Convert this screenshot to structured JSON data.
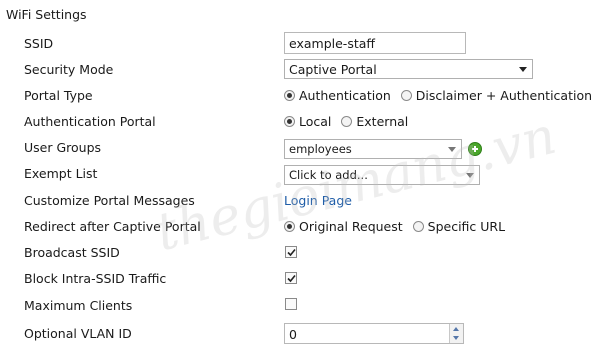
{
  "section_title": "WiFi Settings",
  "fields": {
    "ssid": {
      "label": "SSID",
      "value": "example-staff"
    },
    "security_mode": {
      "label": "Security Mode",
      "value": "Captive Portal"
    },
    "portal_type": {
      "label": "Portal Type",
      "options": [
        "Authentication",
        "Disclaimer + Authentication"
      ],
      "selected": "Authentication"
    },
    "auth_portal": {
      "label": "Authentication Portal",
      "options": [
        "Local",
        "External"
      ],
      "selected": "Local"
    },
    "user_groups": {
      "label": "User Groups",
      "value": "employees"
    },
    "exempt_list": {
      "label": "Exempt List",
      "placeholder": "Click to add..."
    },
    "customize_portal": {
      "label": "Customize Portal Messages",
      "link": "Login Page"
    },
    "redirect": {
      "label": "Redirect after Captive Portal",
      "options": [
        "Original Request",
        "Specific URL"
      ],
      "selected": "Original Request"
    },
    "broadcast_ssid": {
      "label": "Broadcast SSID",
      "checked": true
    },
    "block_intra": {
      "label": "Block Intra-SSID Traffic",
      "checked": true
    },
    "max_clients": {
      "label": "Maximum Clients",
      "checked": false
    },
    "vlan_id": {
      "label": "Optional VLAN ID",
      "value": "0"
    }
  },
  "watermark": "thegioimang.vn",
  "icons": {
    "add": "add-icon",
    "checkmark": "checkmark-icon",
    "dropdown": "chevron-down-icon"
  },
  "colors": {
    "link": "#1f5da8",
    "add_icon": "#4aa62a"
  }
}
